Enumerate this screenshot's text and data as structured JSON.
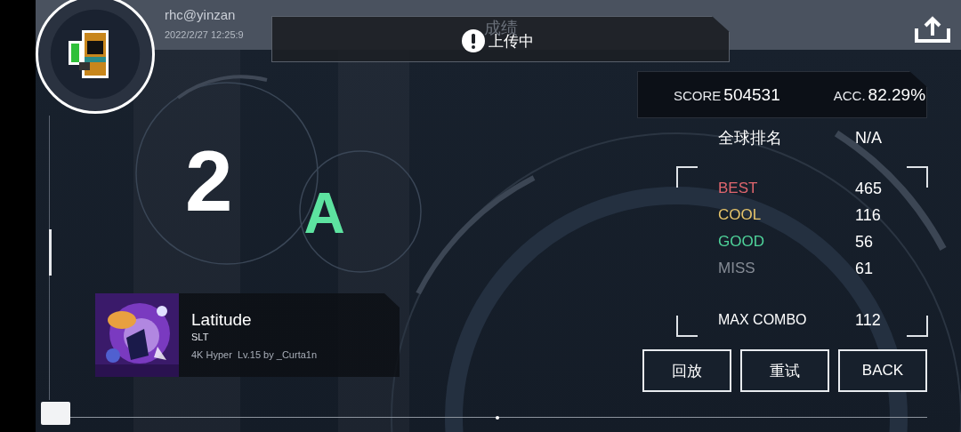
{
  "player": {
    "name": "rhc@yinzan",
    "time": "2022/2/27 12:25:9"
  },
  "title": "成绩",
  "toast": {
    "text": "上传中"
  },
  "result": {
    "number": "2",
    "grade": "A"
  },
  "song": {
    "title": "Latitude",
    "artist": "SLT",
    "chart": "4K Hyper  Lv.15 by _Curta1n"
  },
  "score": {
    "label": "SCORE",
    "value": "504531",
    "acc_label": "ACC.",
    "acc_value": "82.29%"
  },
  "ranking": {
    "label": "全球排名",
    "value": "N/A"
  },
  "judgements": [
    {
      "label": "BEST",
      "value": "465",
      "color": "#e0666e"
    },
    {
      "label": "COOL",
      "value": "116",
      "color": "#e6c46a"
    },
    {
      "label": "GOOD",
      "value": "56",
      "color": "#4fd39a"
    },
    {
      "label": "MISS",
      "value": "61",
      "color": "#858b95"
    }
  ],
  "max_combo": {
    "label": "MAX COMBO",
    "value": "112"
  },
  "buttons": [
    "回放",
    "重试",
    "BACK"
  ]
}
